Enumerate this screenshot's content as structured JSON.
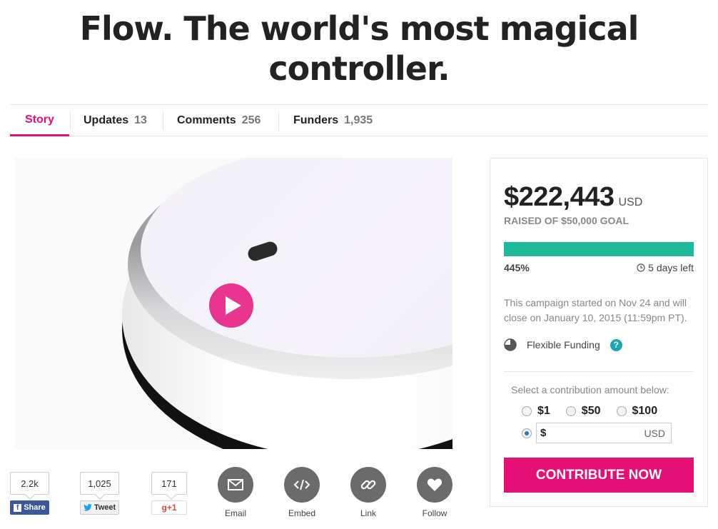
{
  "page": {
    "title": "Flow. The world's most magical controller."
  },
  "tabs": [
    {
      "label": "Story",
      "count": ""
    },
    {
      "label": "Updates",
      "count": "13"
    },
    {
      "label": "Comments",
      "count": "256"
    },
    {
      "label": "Funders",
      "count": "1,935"
    }
  ],
  "campaign": {
    "amount": "$222,443",
    "currency": "USD",
    "goal_text": "RAISED OF $50,000 GOAL",
    "percent_text": "445%",
    "progress_fraction": 1.0,
    "days_left": "5 days left",
    "started_text": "This campaign started on Nov 24 and will close on January 10, 2015 (11:59pm PT).",
    "funding_type": "Flexible Funding",
    "help_glyph": "?",
    "select_label": "Select a contribution amount below:",
    "amount_options": [
      "$1",
      "$50",
      "$100"
    ],
    "custom_symbol": "$",
    "custom_currency": "USD",
    "contribute_label": "CONTRIBUTE NOW"
  },
  "share": {
    "facebook_count": "2.2k",
    "facebook_label": "Share",
    "facebook_glyph": "f",
    "twitter_count": "1,025",
    "twitter_label": "Tweet",
    "gplus_count": "171",
    "gplus_label": "g+1"
  },
  "actions": [
    {
      "label": "Email",
      "icon": "envelope-icon"
    },
    {
      "label": "Embed",
      "icon": "code-icon"
    },
    {
      "label": "Link",
      "icon": "link-icon"
    },
    {
      "label": "Follow",
      "icon": "heart-icon"
    }
  ],
  "colors": {
    "accent": "#e51075",
    "progress": "#1fba9b",
    "play": "#e9358f",
    "help": "#19a7b3",
    "facebook": "#3b5998"
  }
}
